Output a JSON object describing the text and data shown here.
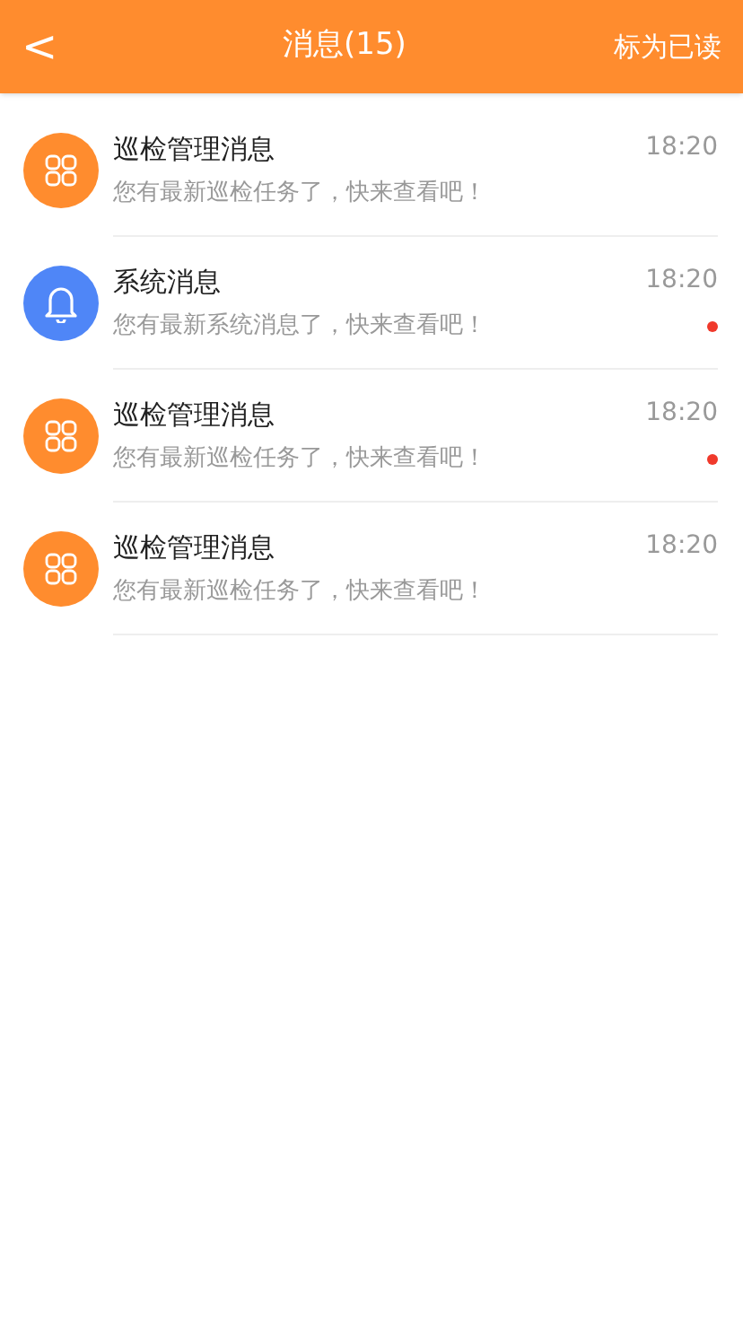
{
  "header": {
    "back": "<",
    "title": "消息(15)",
    "action": "标为已读"
  },
  "messages": [
    {
      "kind": "patrol",
      "title": "巡检管理消息",
      "time": "18:20",
      "preview": "您有最新巡检任务了，快来查看吧！",
      "unread": false
    },
    {
      "kind": "system",
      "title": "系统消息",
      "time": "18:20",
      "preview": "您有最新系统消息了，快来查看吧！",
      "unread": true
    },
    {
      "kind": "patrol",
      "title": "巡检管理消息",
      "time": "18:20",
      "preview": "您有最新巡检任务了，快来查看吧！",
      "unread": true
    },
    {
      "kind": "patrol",
      "title": "巡检管理消息",
      "time": "18:20",
      "preview": "您有最新巡检任务了，快来查看吧！",
      "unread": false
    }
  ]
}
